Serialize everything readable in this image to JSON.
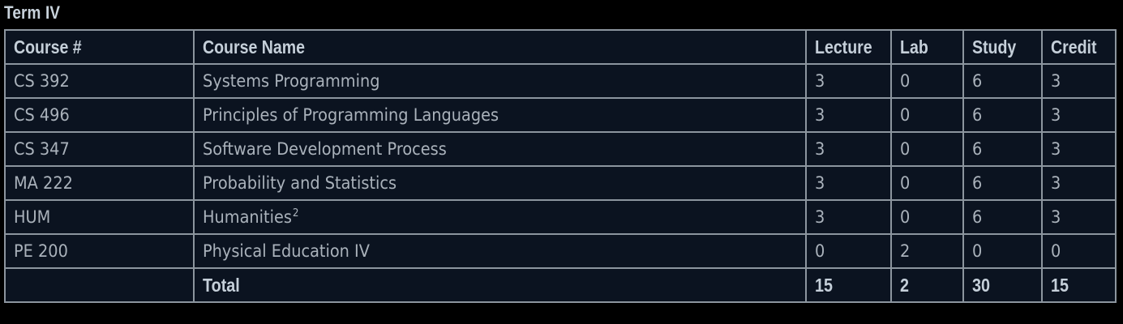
{
  "title": "Term IV",
  "headers": {
    "course_num": "Course #",
    "course_name": "Course Name",
    "lecture": "Lecture",
    "lab": "Lab",
    "study": "Study",
    "credit": "Credit"
  },
  "rows": [
    {
      "course_num": "CS 392",
      "course_name": "Systems Programming",
      "footnote": "",
      "lecture": "3",
      "lab": "0",
      "study": "6",
      "credit": "3"
    },
    {
      "course_num": "CS 496",
      "course_name": "Principles of Programming Languages",
      "footnote": "",
      "lecture": "3",
      "lab": "0",
      "study": "6",
      "credit": "3"
    },
    {
      "course_num": "CS 347",
      "course_name": "Software Development Process",
      "footnote": "",
      "lecture": "3",
      "lab": "0",
      "study": "6",
      "credit": "3"
    },
    {
      "course_num": "MA 222",
      "course_name": "Probability and Statistics",
      "footnote": "",
      "lecture": "3",
      "lab": "0",
      "study": "6",
      "credit": "3"
    },
    {
      "course_num": "HUM",
      "course_name": "Humanities",
      "footnote": "2",
      "lecture": "3",
      "lab": "0",
      "study": "6",
      "credit": "3"
    },
    {
      "course_num": "PE 200",
      "course_name": "Physical Education IV",
      "footnote": "",
      "lecture": "0",
      "lab": "2",
      "study": "0",
      "credit": "0"
    }
  ],
  "total": {
    "course_num": "",
    "label": "Total",
    "lecture": "15",
    "lab": "2",
    "study": "30",
    "credit": "15"
  }
}
